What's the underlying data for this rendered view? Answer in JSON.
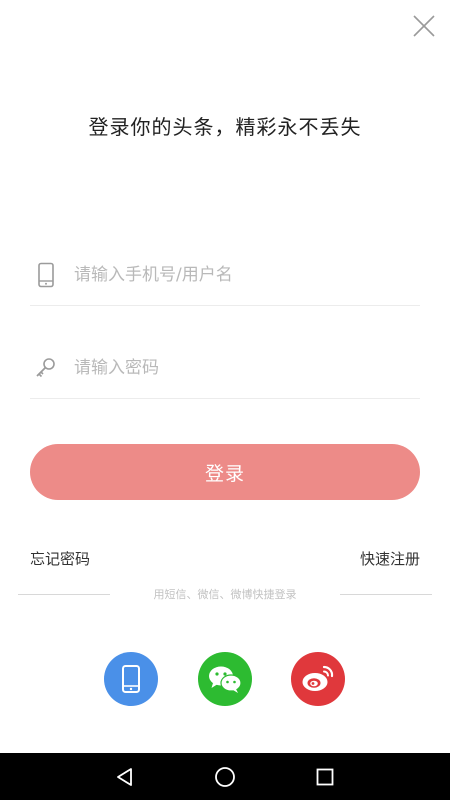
{
  "header": {
    "headline": "登录你的头条，精彩永不丢失"
  },
  "form": {
    "username_placeholder": "请输入手机号/用户名",
    "username_value": "",
    "password_placeholder": "请输入密码",
    "password_value": "",
    "login_label": "登录"
  },
  "links": {
    "forgot_password": "忘记密码",
    "quick_register": "快速注册"
  },
  "alt_login": {
    "divider_text": "用短信、微信、微博快捷登录",
    "options": [
      {
        "icon": "phone-icon",
        "color": "#4a90e8"
      },
      {
        "icon": "wechat-icon",
        "color": "#2dbb31"
      },
      {
        "icon": "weibo-icon",
        "color": "#e0383c"
      }
    ]
  },
  "colors": {
    "login_button": "#ed8b88",
    "navbar": "#000000"
  }
}
